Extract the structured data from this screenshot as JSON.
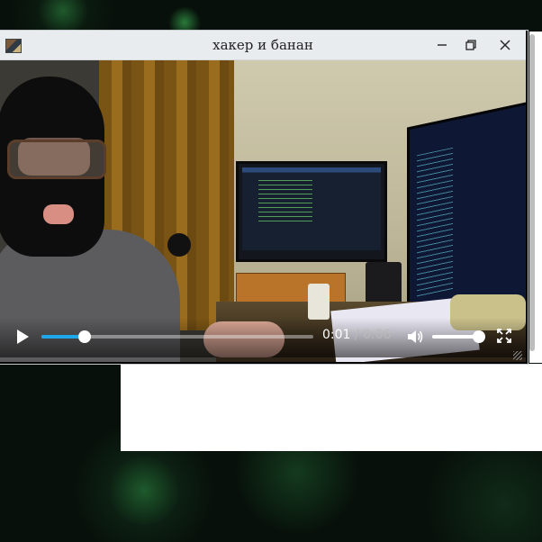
{
  "window": {
    "title": "хакер и банан",
    "app_icon": "video-thumbnail-icon",
    "buttons": {
      "minimize": "minimize-icon",
      "maximize": "restore-icon",
      "close": "close-icon"
    }
  },
  "player": {
    "current_time": "0:01",
    "separator": "/",
    "duration": "0:06",
    "progress_fraction": 0.16,
    "volume_fraction": 0.9,
    "accent_color": "#1ea7ea",
    "icons": {
      "play": "play-icon",
      "volume": "volume-icon",
      "fullscreen": "fullscreen-icon"
    }
  }
}
